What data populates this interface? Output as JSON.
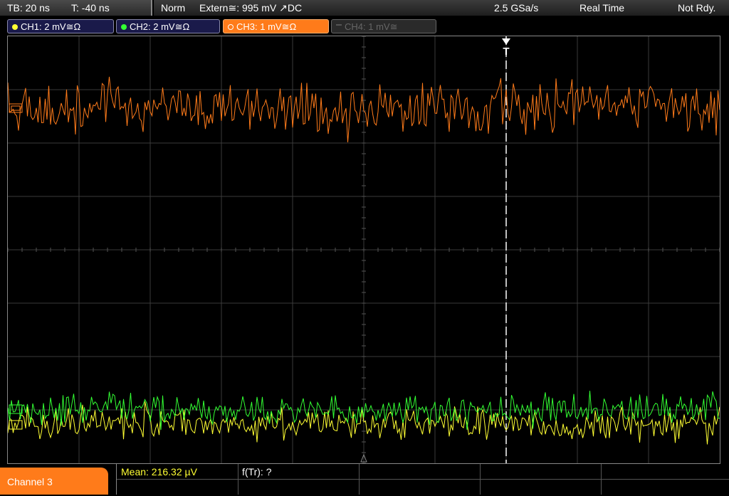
{
  "timebase": {
    "tb": "TB: 20 ns",
    "t": "T: -40 ns"
  },
  "status": {
    "mode": "Norm",
    "trigger": "Extern≅: 995 mV ↗DC",
    "sample_rate": "2.5 GSa/s",
    "acq_mode": "Real Time",
    "ready": "Not Rdy."
  },
  "channels": [
    {
      "label": "CH1: 2 mV≅Ω",
      "color": "#ffff33",
      "state": "on"
    },
    {
      "label": "CH2: 2 mV≅Ω",
      "color": "#33ff33",
      "state": "on"
    },
    {
      "label": "CH3: 1 mV≅Ω",
      "color": "#ff7b1a",
      "state": "active"
    },
    {
      "label": "CH4: 1 mV≅",
      "color": "#666666",
      "state": "off"
    }
  ],
  "trigger_marker": "T",
  "bottom": {
    "channel_label": "Channel 3",
    "mean": "Mean: 216.32 µV",
    "ftr": "f(Tr): ?"
  },
  "colors": {
    "ch1": "#ffff33",
    "ch2": "#33ff33",
    "ch3": "#ff7b1a",
    "grid": "#3a3a3a",
    "accent": "#ff7b1a"
  }
}
